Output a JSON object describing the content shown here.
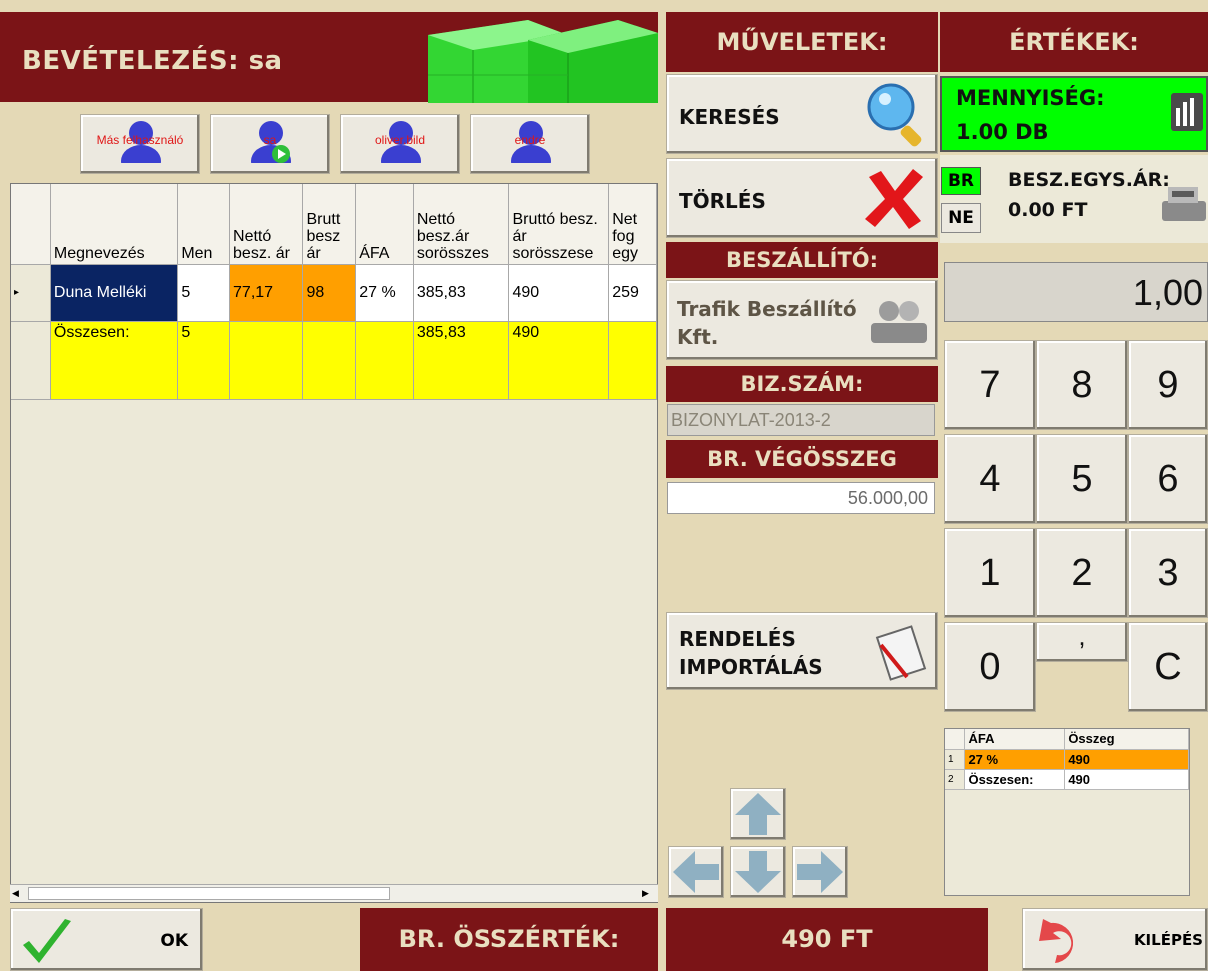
{
  "header": {
    "title": "BEVÉTELEZÉS: sa"
  },
  "users": [
    {
      "label": "Más felhasználó"
    },
    {
      "label": "sa"
    },
    {
      "label": "oliver.bild"
    },
    {
      "label": "endre"
    }
  ],
  "grid": {
    "columns": [
      "Megnevezés",
      "Men",
      "Nettó besz. ár",
      "Brutt besz ár",
      "ÁFA",
      "Nettó besz.ár sorösszes",
      "Bruttó besz. ár sorösszese",
      "Net fog egy"
    ],
    "rows": [
      [
        "Duna Melléki",
        "5",
        "77,17",
        "98",
        "27 %",
        "385,83",
        "490",
        "259"
      ]
    ],
    "total_row": [
      "Összesen:",
      "5",
      "",
      "",
      "",
      "385,83",
      "490",
      ""
    ]
  },
  "operations": {
    "header": "MŰVELETEK:",
    "search_label": "KERESÉS",
    "delete_label": "TÖRLÉS",
    "supplier_header": "BESZÁLLÍTÓ:",
    "supplier_name": "Trafik Beszállító Kft.",
    "doc_number_header": "BIZ.SZÁM:",
    "doc_number": "BIZONYLAT-2013-2",
    "gross_total_header": "BR. VÉGÖSSZEG",
    "gross_total_value": "56.000,00",
    "import_label": "RENDELÉS IMPORTÁLÁS"
  },
  "values": {
    "header": "ÉRTÉKEK:",
    "quantity_label": "MENNYISÉG:",
    "quantity_value": "1.00 DB",
    "br_tag": "BR",
    "ne_tag": "NE",
    "unit_price_label": "BESZ.EGYS.ÁR:",
    "unit_price_value": "0.00 FT",
    "display": "1,00"
  },
  "keypad": [
    "7",
    "8",
    "9",
    "4",
    "5",
    "6",
    "1",
    "2",
    "3",
    "0",
    ",",
    "C"
  ],
  "vat_summary": {
    "columns": [
      "ÁFA",
      "Összeg"
    ],
    "rows": [
      [
        "1",
        "27 %",
        "490"
      ],
      [
        "2",
        "Összesen:",
        "490"
      ]
    ]
  },
  "footer": {
    "ok_label": "OK",
    "total_label": "BR. ÖSSZÉRTÉK:",
    "total_value": "490 FT",
    "exit_label": "KILÉPÉS"
  },
  "colors": {
    "maroon": "#7b1417",
    "beige": "#e4d9b6",
    "quantity_green": "#00ff00",
    "highlight_orange": "#ff9f00",
    "total_yellow": "#ffff00",
    "selected_navy": "#0a2463"
  }
}
